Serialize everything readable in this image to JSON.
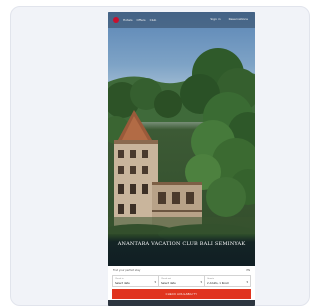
{
  "site": {
    "nav": [
      "Hotels",
      "Offers",
      "Club"
    ],
    "nav_right": [
      "Sign in",
      "Reservations"
    ]
  },
  "hero": {
    "title": "ANANTARA VACATION CLUB BALI SEMINYAK"
  },
  "booking": {
    "header": "Find your perfect stay",
    "header_right": "EN",
    "fields": [
      {
        "label": "Check in",
        "value": "Select date"
      },
      {
        "label": "Check out",
        "value": "Select date"
      },
      {
        "label": "Guests",
        "value": "2 Adults, 1 Room"
      }
    ],
    "search_label": "CHECK AVAILABILITY"
  },
  "colors": {
    "brand": "#c8102e",
    "cta": "#e0341f"
  }
}
